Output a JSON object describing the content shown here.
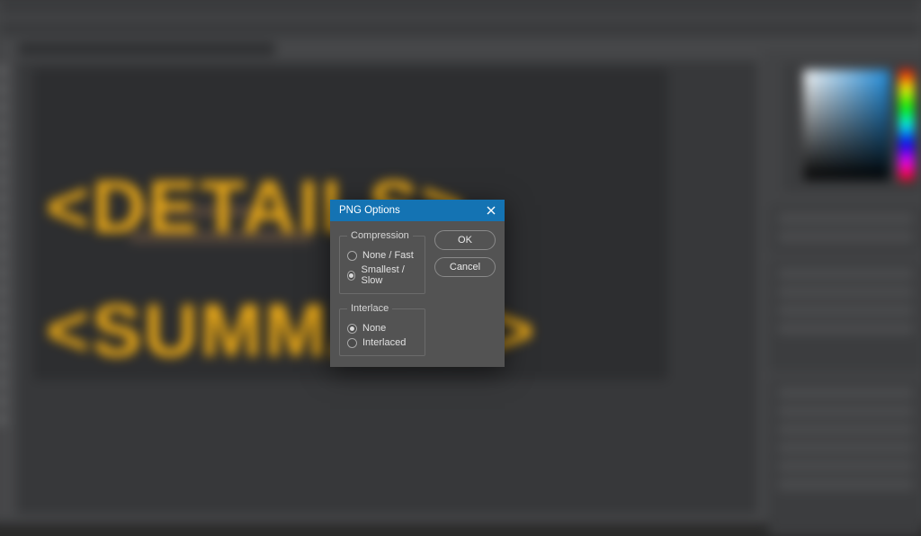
{
  "dialog": {
    "title": "PNG Options",
    "buttons": {
      "ok": "OK",
      "cancel": "Cancel"
    },
    "groups": {
      "compression": {
        "legend": "Compression",
        "options": {
          "none_fast": "None / Fast",
          "smallest_slow": "Smallest / Slow"
        },
        "selected": "smallest_slow"
      },
      "interlace": {
        "legend": "Interlace",
        "options": {
          "none": "None",
          "interlaced": "Interlaced"
        },
        "selected": "none"
      }
    }
  },
  "background": {
    "big_text_1": "<DETAILS>",
    "big_text_2": "<SUMMARY>"
  },
  "colors": {
    "accent_title": "#1473b3",
    "dialog_bg": "#535353",
    "canvas_text": "#e9a91a"
  }
}
